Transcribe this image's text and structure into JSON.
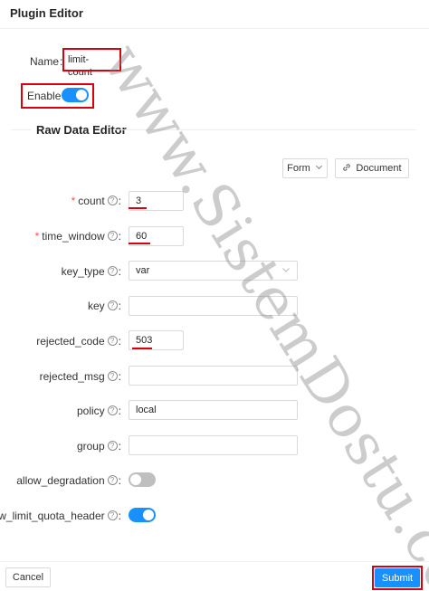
{
  "header": {
    "title": "Plugin Editor"
  },
  "plugin": {
    "name_label": "Name",
    "name_value": "limit-count",
    "enable_label": "Enable",
    "enabled": true
  },
  "raw_data": {
    "title": "Raw Data Editor",
    "form_select": "Form",
    "document_button": "Document"
  },
  "fields": {
    "count": {
      "label": "count",
      "value": "3",
      "required": true
    },
    "time_window": {
      "label": "time_window",
      "value": "60",
      "required": true
    },
    "key_type": {
      "label": "key_type",
      "value": "var"
    },
    "key": {
      "label": "key",
      "value": ""
    },
    "rejected_code": {
      "label": "rejected_code",
      "value": "503"
    },
    "rejected_msg": {
      "label": "rejected_msg",
      "value": ""
    },
    "policy": {
      "label": "policy",
      "value": "local"
    },
    "group": {
      "label": "group",
      "value": ""
    },
    "allow_degradation": {
      "label": "allow_degradation",
      "enabled": false
    },
    "show_limit_quota_header": {
      "label": "show_limit_quota_header",
      "enabled": true
    }
  },
  "footer": {
    "cancel_label": "Cancel",
    "submit_label": "Submit"
  },
  "watermark": {
    "text": "www.SistemDostu.com"
  },
  "colors": {
    "accent": "#1890ff",
    "highlight": "#d9000d",
    "required": "#ff4d4f"
  },
  "icons": [
    "question-circle-icon",
    "chevron-down-icon",
    "link-icon"
  ]
}
